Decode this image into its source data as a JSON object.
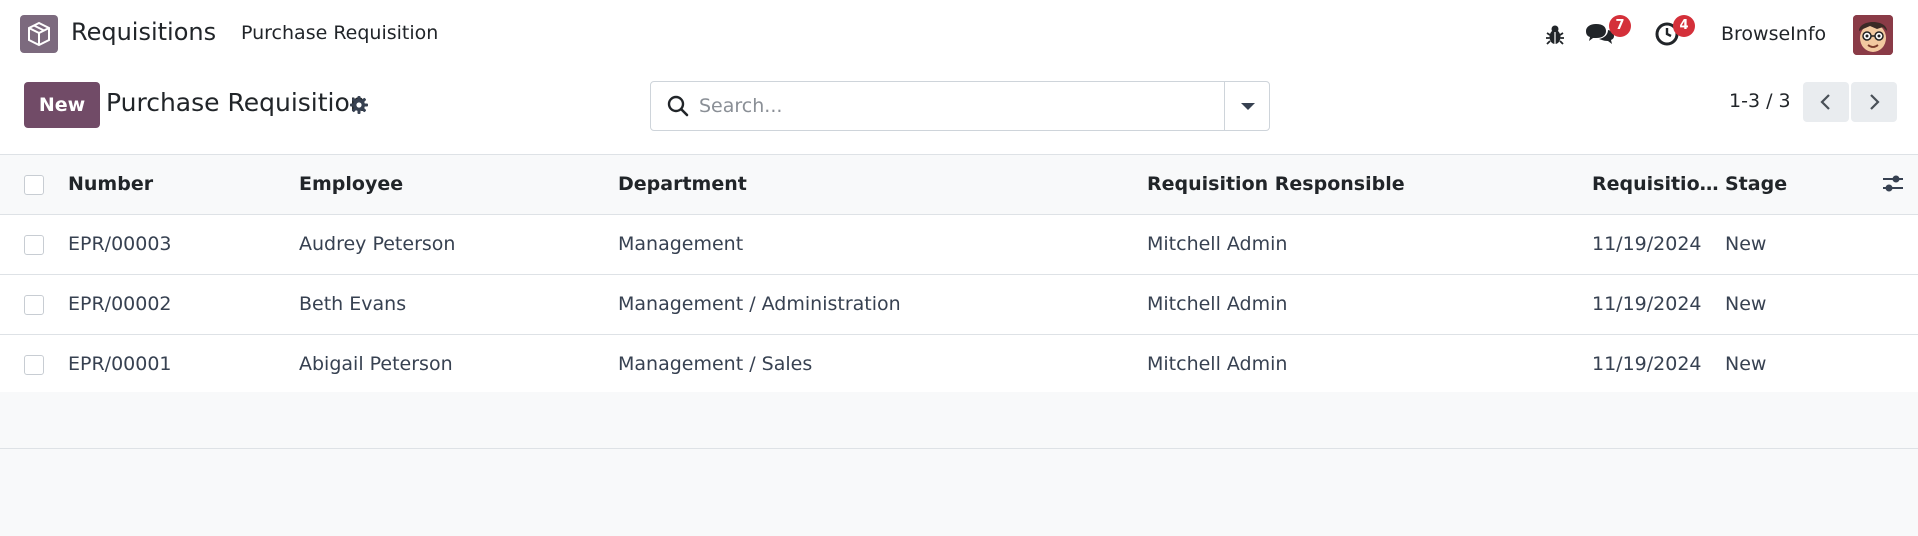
{
  "navbar": {
    "app_name": "Requisitions",
    "menu_item": "Purchase Requisition",
    "messages_count": "7",
    "activities_count": "4",
    "company": "BrowseInfo"
  },
  "control": {
    "new_label": "New",
    "title": "Purchase Requisition",
    "search_placeholder": "Search...",
    "pager": "1-3 / 3"
  },
  "table": {
    "headers": [
      "Number",
      "Employee",
      "Department",
      "Requisition Responsible",
      "Requisitio...",
      "Stage"
    ],
    "rows": [
      [
        "EPR/00003",
        "Audrey Peterson",
        "Management",
        "Mitchell Admin",
        "11/19/2024",
        "New"
      ],
      [
        "EPR/00002",
        "Beth Evans",
        "Management / Administration",
        "Mitchell Admin",
        "11/19/2024",
        "New"
      ],
      [
        "EPR/00001",
        "Abigail Peterson",
        "Management / Sales",
        "Mitchell Admin",
        "11/19/2024",
        "New"
      ]
    ]
  },
  "colors": {
    "brand": "#714b67",
    "badge": "#d4303a",
    "background": "#f8f9fa"
  }
}
